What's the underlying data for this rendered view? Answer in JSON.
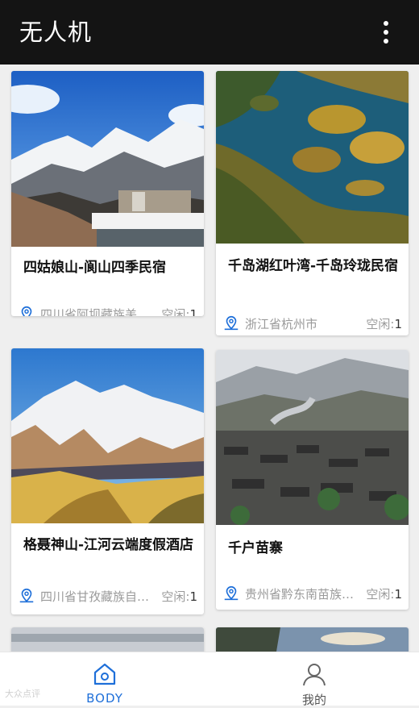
{
  "app": {
    "title": "无人机"
  },
  "cards": [
    {
      "name": "四姑娘山-阆山四季民宿",
      "location": "四川省阿坝藏族羌族自治州",
      "idle_label": "空闲:",
      "idle_value": "1"
    },
    {
      "name": "千岛湖红叶湾-千岛玲珑民宿",
      "location": "浙江省杭州市",
      "idle_label": "空闲:",
      "idle_value": "1"
    },
    {
      "name": "格聂神山-江河云端度假酒店",
      "location": "四川省甘孜藏族自治州",
      "idle_label": "空闲:",
      "idle_value": "1"
    },
    {
      "name": "千户苗寨",
      "location": "贵州省黔东南苗族侗族自治州",
      "idle_label": "空闲:",
      "idle_value": "1"
    }
  ],
  "nav": {
    "home_label": "BODY",
    "profile_label": "我的"
  },
  "colors": {
    "accent": "#1e6fd9",
    "appbar": "#141414"
  },
  "watermark": "大众点评"
}
